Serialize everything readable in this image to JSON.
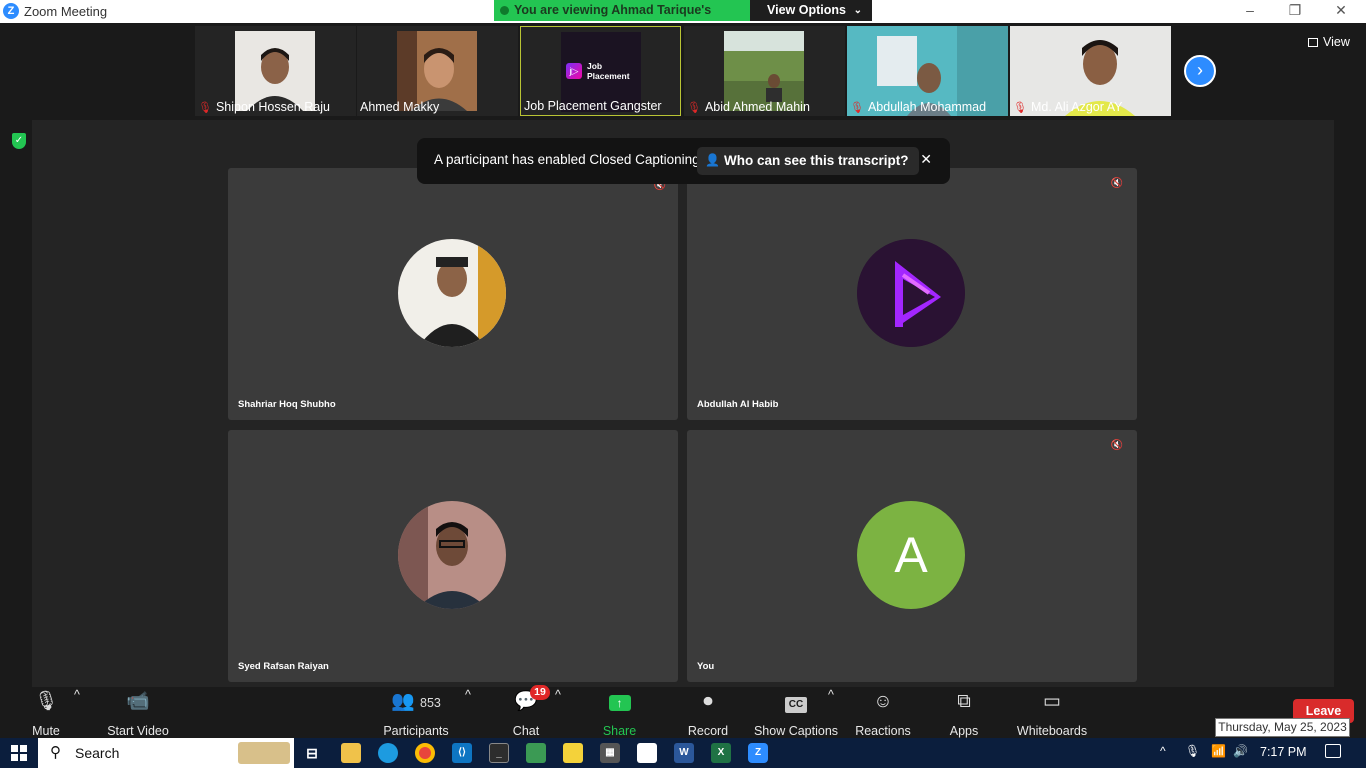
{
  "window": {
    "title": "Zoom Meeting"
  },
  "banner": {
    "viewing_text": "You are viewing Ahmad Tarique's screen",
    "view_options_label": "View Options"
  },
  "thumbnails": [
    {
      "name": "Shipon Hossen Raju",
      "muted": true
    },
    {
      "name": "Ahmed Makky",
      "muted": false
    },
    {
      "name": "Job Placement Gangster",
      "muted": false,
      "logo_line1": "Job",
      "logo_line2": "Placement"
    },
    {
      "name": "Abid Ahmed Mahin",
      "muted": true
    },
    {
      "name": "Abdullah Mohammad",
      "muted": true
    },
    {
      "name": "Md. Ali Azgor AY",
      "muted": true
    }
  ],
  "view_button": {
    "label": "View"
  },
  "notification": {
    "message": "A participant has enabled Closed Captioning",
    "who_can_see": "Who can see this transcript?"
  },
  "participants_grid": [
    {
      "name": "Shahriar Hoq Shubho"
    },
    {
      "name": "Abdullah Al Habib"
    },
    {
      "name": "Syed Rafsan Raiyan"
    },
    {
      "name": "You",
      "initial": "A"
    }
  ],
  "toolbar": {
    "mute": "Mute",
    "start_video": "Start Video",
    "participants": "Participants",
    "participants_count": "853",
    "chat": "Chat",
    "chat_badge": "19",
    "share_screen": "Share Screen",
    "record": "Record",
    "show_captions": "Show Captions",
    "reactions": "Reactions",
    "apps": "Apps",
    "whiteboards": "Whiteboards",
    "leave": "Leave"
  },
  "date_tooltip": "Thursday, May 25, 2023",
  "taskbar": {
    "search": "Search",
    "time": "7:17 PM"
  },
  "colors": {
    "zoom_blue": "#2d8cff",
    "share_green": "#23c552",
    "leave_red": "#d92b2b",
    "avatar_green": "#7cb342"
  }
}
